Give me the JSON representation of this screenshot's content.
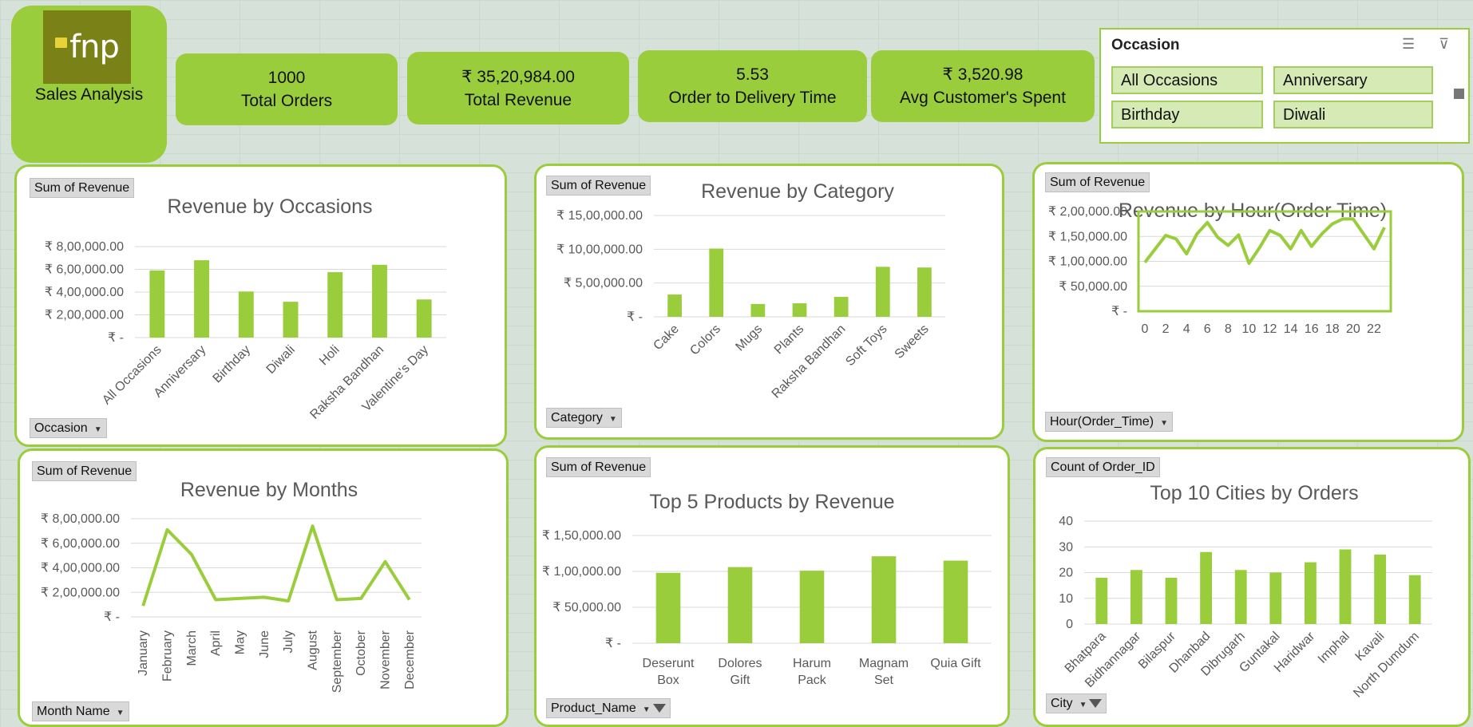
{
  "branding": {
    "logo_text": "fnp",
    "caption": "Sales Analysis"
  },
  "kpis": [
    {
      "value": "1000",
      "label": "Total Orders"
    },
    {
      "value": "₹ 35,20,984.00",
      "label": "Total Revenue"
    },
    {
      "value": "5.53",
      "label": "Order to Delivery Time"
    },
    {
      "value": "₹ 3,520.98",
      "label": "Avg Customer's Spent"
    }
  ],
  "slicer": {
    "title": "Occasion",
    "items": [
      "All Occasions",
      "Anniversary",
      "Birthday",
      "Diwali"
    ]
  },
  "colors": {
    "accent": "#9acd3b",
    "logo_bg": "#7a8117",
    "bar": "#9acd3b"
  },
  "chart_data": [
    {
      "type": "bar",
      "title": "Revenue by Occasions",
      "value_field": "Sum of Revenue",
      "axis_field": "Occasion",
      "categories": [
        "All Occasions",
        "Anniversary",
        "Birthday",
        "Diwali",
        "Holi",
        "Raksha Bandhan",
        "Valentine's Day"
      ],
      "values": [
        590000,
        680000,
        405000,
        315000,
        575000,
        640000,
        335000
      ],
      "ylim": [
        0,
        800000
      ],
      "yticks": [
        0,
        200000,
        400000,
        600000,
        800000
      ],
      "ytick_labels": [
        "₹ -",
        "₹ 2,00,000.00",
        "₹ 4,00,000.00",
        "₹ 6,00,000.00",
        "₹ 8,00,000.00"
      ],
      "grid": true
    },
    {
      "type": "bar",
      "title": "Revenue by Category",
      "value_field": "Sum of Revenue",
      "axis_field": "Category",
      "categories": [
        "Cake",
        "Colors",
        "Mugs",
        "Plants",
        "Raksha Bandhan",
        "Soft Toys",
        "Sweets"
      ],
      "values": [
        330000,
        1010000,
        190000,
        200000,
        295000,
        740000,
        730000
      ],
      "ylim": [
        0,
        1500000
      ],
      "yticks": [
        0,
        500000,
        1000000,
        1500000
      ],
      "ytick_labels": [
        "₹ -",
        "₹ 5,00,000.00",
        "₹ 10,00,000.00",
        "₹ 15,00,000.00"
      ],
      "grid": true
    },
    {
      "type": "line",
      "title": "Revenue by Hour(Order Time)",
      "value_field": "Sum of Revenue",
      "axis_field": "Hour(Order_Time)",
      "x": [
        0,
        1,
        2,
        3,
        4,
        5,
        6,
        7,
        8,
        9,
        10,
        11,
        12,
        13,
        14,
        15,
        16,
        17,
        18,
        19,
        20,
        21,
        22,
        23
      ],
      "values": [
        98000,
        125000,
        152000,
        145000,
        115000,
        155000,
        178000,
        148000,
        132000,
        153000,
        96000,
        127000,
        162000,
        152000,
        125000,
        162000,
        130000,
        155000,
        175000,
        185000,
        185000,
        155000,
        125000,
        168000
      ],
      "xtick_labels": [
        "0",
        "2",
        "4",
        "6",
        "8",
        "10",
        "12",
        "14",
        "16",
        "18",
        "20",
        "22"
      ],
      "ylim": [
        0,
        200000
      ],
      "yticks": [
        0,
        50000,
        100000,
        150000,
        200000
      ],
      "ytick_labels": [
        "₹ -",
        "₹ 50,000.00",
        "₹ 1,00,000.00",
        "₹ 1,50,000.00",
        "₹ 2,00,000.00"
      ],
      "grid": true
    },
    {
      "type": "line",
      "title": "Revenue by Months",
      "value_field": "Sum of Revenue",
      "axis_field": "Month Name",
      "categories": [
        "January",
        "February",
        "March",
        "April",
        "May",
        "June",
        "July",
        "August",
        "September",
        "October",
        "November",
        "December"
      ],
      "values": [
        90000,
        710000,
        510000,
        140000,
        150000,
        160000,
        130000,
        740000,
        140000,
        150000,
        450000,
        140000
      ],
      "ylim": [
        0,
        800000
      ],
      "yticks": [
        0,
        200000,
        400000,
        600000,
        800000
      ],
      "ytick_labels": [
        "₹ -",
        "₹ 2,00,000.00",
        "₹ 4,00,000.00",
        "₹ 6,00,000.00",
        "₹ 8,00,000.00"
      ],
      "grid": true
    },
    {
      "type": "bar",
      "title": "Top 5 Products by Revenue",
      "value_field": "Sum of Revenue",
      "axis_field": "Product_Name",
      "categories": [
        "Deserunt Box",
        "Dolores Gift",
        "Harum Pack",
        "Magnam Set",
        "Quia Gift"
      ],
      "category_lines": [
        [
          "Deserunt",
          "Box"
        ],
        [
          "Dolores",
          "Gift"
        ],
        [
          "Harum",
          "Pack"
        ],
        [
          "Magnam",
          "Set"
        ],
        [
          "Quia Gift"
        ]
      ],
      "values": [
        98000,
        106000,
        101000,
        121000,
        115000
      ],
      "ylim": [
        0,
        150000
      ],
      "yticks": [
        0,
        50000,
        100000,
        150000
      ],
      "ytick_labels": [
        "₹ -",
        "₹ 50,000.00",
        "₹ 1,00,000.00",
        "₹ 1,50,000.00"
      ],
      "grid": true
    },
    {
      "type": "bar",
      "title": "Top 10 Cities by Orders",
      "value_field": "Count of Order_ID",
      "axis_field": "City",
      "categories": [
        "Bhatpara",
        "Bidhannagar",
        "Bilaspur",
        "Dhanbad",
        "Dibrugarh",
        "Guntakal",
        "Haridwar",
        "Imphal",
        "Kavali",
        "North Dumdum"
      ],
      "values": [
        18,
        21,
        18,
        28,
        21,
        20,
        24,
        29,
        27,
        19
      ],
      "ylim": [
        0,
        40
      ],
      "yticks": [
        0,
        10,
        20,
        30,
        40
      ],
      "ytick_labels": [
        "0",
        "10",
        "20",
        "30",
        "40"
      ],
      "grid": true
    }
  ]
}
